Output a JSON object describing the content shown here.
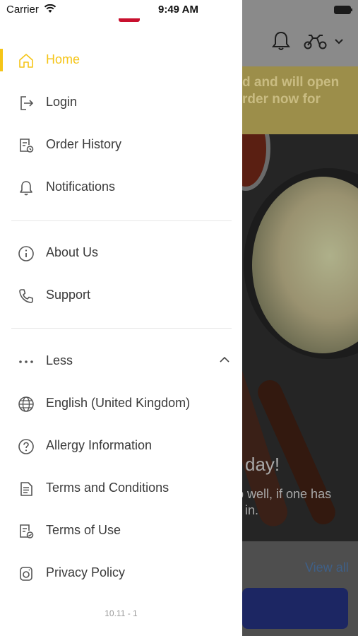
{
  "status_bar": {
    "carrier": "Carrier",
    "time": "9:49 AM"
  },
  "background": {
    "banner_lines": [
      "d and will open",
      "rder now for"
    ],
    "hero_title": "day!",
    "hero_sub_lines": [
      "p well, if one has",
      "in."
    ],
    "view_all": "View all"
  },
  "menu": {
    "home": "Home",
    "login": "Login",
    "order_history": "Order History",
    "notifications": "Notifications",
    "about_us": "About Us",
    "support": "Support",
    "less": "Less",
    "language": "English (United Kingdom)",
    "allergy": "Allergy Information",
    "terms_conditions": "Terms and Conditions",
    "terms_use": "Terms of Use",
    "privacy": "Privacy Policy"
  },
  "version": "10.11 - 1",
  "colors": {
    "accent": "#f5c518",
    "text": "#3a3a3a",
    "icon": "#555555",
    "divider": "#e6e6e6"
  }
}
